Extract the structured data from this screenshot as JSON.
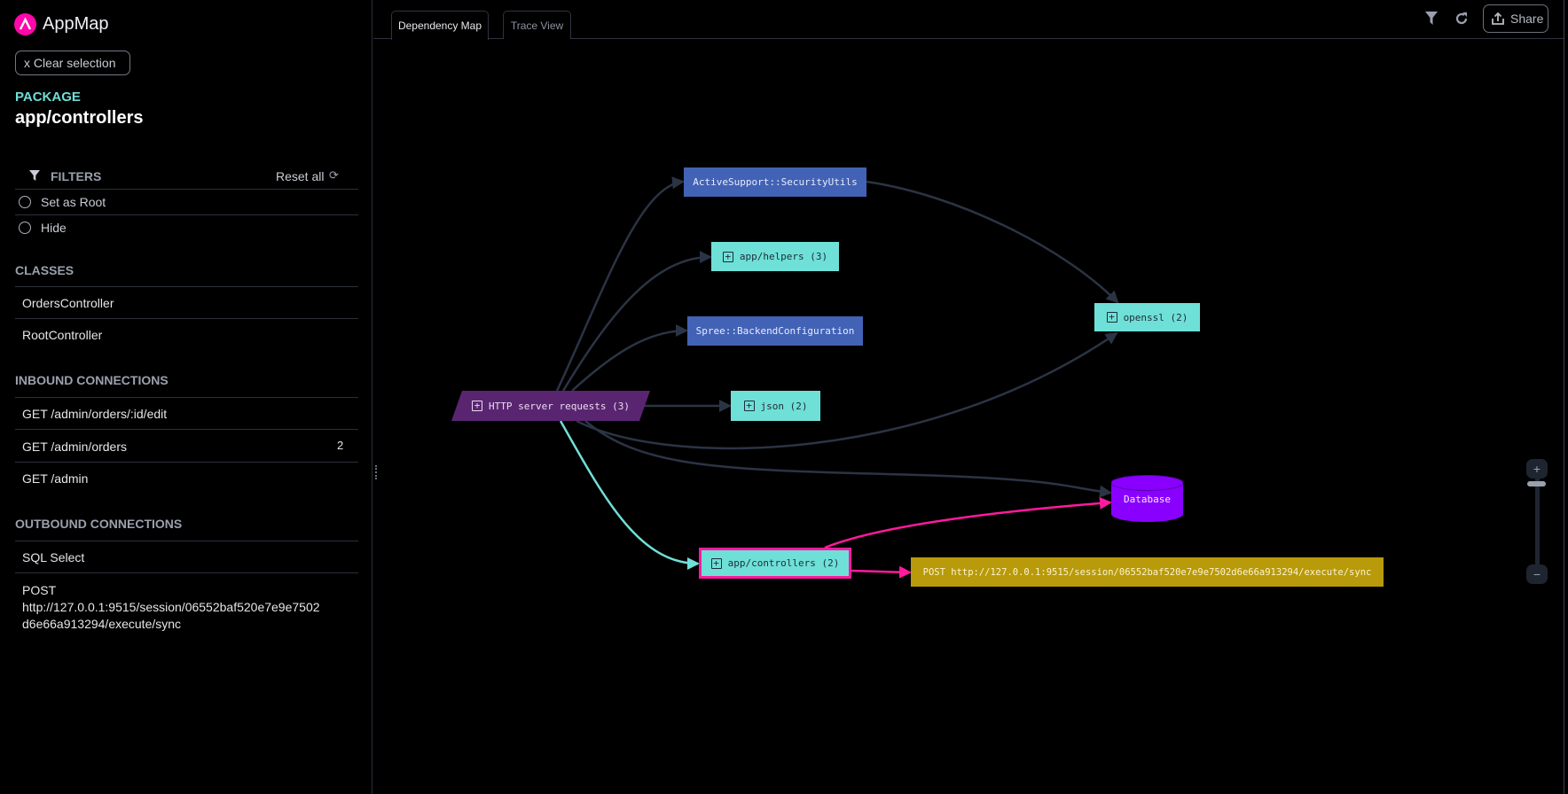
{
  "app": {
    "title": "AppMap",
    "brand_color": "#ff07aa"
  },
  "sidebar": {
    "clear_selection": "x  Clear selection",
    "selection_type": "PACKAGE",
    "selection_name": "app/controllers",
    "filters": {
      "label": "FILTERS",
      "reset_label": "Reset all",
      "options": [
        {
          "label": "Set as Root",
          "checked": false
        },
        {
          "label": "Hide",
          "checked": false
        }
      ]
    },
    "classes": {
      "label": "CLASSES",
      "items": [
        "OrdersController",
        "RootController"
      ]
    },
    "inbound": {
      "label": "INBOUND CONNECTIONS",
      "items": [
        {
          "label": "GET /admin/orders/:id/edit",
          "count": ""
        },
        {
          "label": "GET /admin/orders",
          "count": "2"
        },
        {
          "label": "GET /admin",
          "count": ""
        }
      ]
    },
    "outbound": {
      "label": "OUTBOUND CONNECTIONS",
      "items": [
        "SQL Select",
        "POST",
        "http://127.0.0.1:9515/session/06552baf520e7e9e7502",
        "d6e66a913294/execute/sync"
      ]
    }
  },
  "main": {
    "tabs": [
      {
        "label": "Dependency Map",
        "active": true
      },
      {
        "label": "Trace View",
        "active": false
      }
    ],
    "toolbar": {
      "filter_icon": "funnel-icon",
      "reload_icon": "refresh-icon",
      "share_label": "Share"
    },
    "graph": {
      "nodes": {
        "http": "HTTP server requests (3)",
        "security": "ActiveSupport::SecurityUtils",
        "helpers": "app/helpers (3)",
        "spree": "Spree::BackendConfiguration",
        "json": "json (2)",
        "openssl": "openssl (2)",
        "database": "Database",
        "controllers": "app/controllers (2)",
        "post": "POST http://127.0.0.1:9515/session/06552baf520e7e9e7502d6e66a913294/execute/sync"
      },
      "colors": {
        "class": "#4262b5",
        "package": "#6fe0d8",
        "http": "#5a2570",
        "database": "#8a00ff",
        "external": "#b89a0a",
        "selected": "#ff1a9e",
        "edge": "#2b3445",
        "inbound_edge": "#6fe0d8"
      }
    },
    "zoom": {
      "plus": "+",
      "minus": "−"
    }
  }
}
